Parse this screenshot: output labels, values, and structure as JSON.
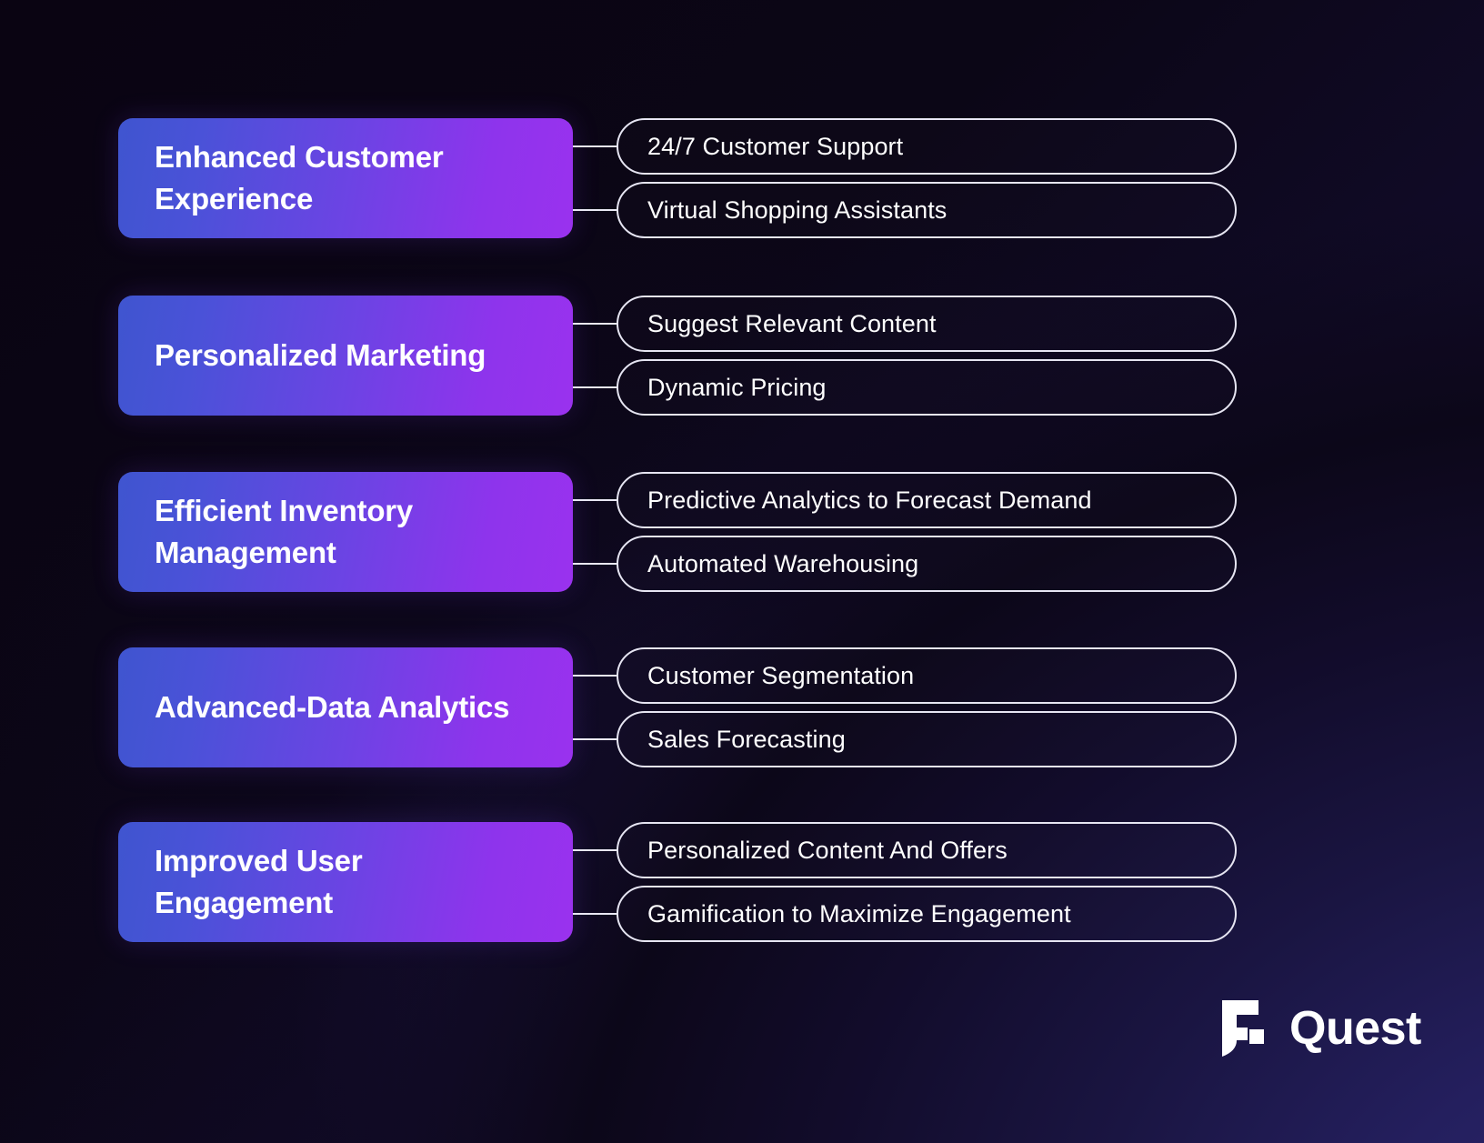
{
  "theme": {
    "background_dark": "#0b0615",
    "background_accent": "#2e2870",
    "card_gradient_start": "#3f55cf",
    "card_gradient_end": "#9a32ee",
    "pill_border": "#e6e5f2",
    "text_color": "#ffffff"
  },
  "brand": {
    "name": "Quest",
    "mark_icon": "quest-shield-icon"
  },
  "groups": [
    {
      "title": "Enhanced Customer Experience",
      "items": [
        "24/7 Customer Support",
        "Virtual Shopping Assistants"
      ]
    },
    {
      "title": "Personalized Marketing",
      "items": [
        "Suggest Relevant Content",
        "Dynamic Pricing"
      ]
    },
    {
      "title": "Efficient Inventory Management",
      "items": [
        "Predictive Analytics to Forecast Demand",
        "Automated Warehousing"
      ]
    },
    {
      "title": "Advanced-Data Analytics",
      "items": [
        "Customer Segmentation",
        "Sales Forecasting"
      ]
    },
    {
      "title": "Improved User Engagement",
      "items": [
        "Personalized Content And Offers",
        "Gamification to Maximize Engagement"
      ]
    }
  ]
}
